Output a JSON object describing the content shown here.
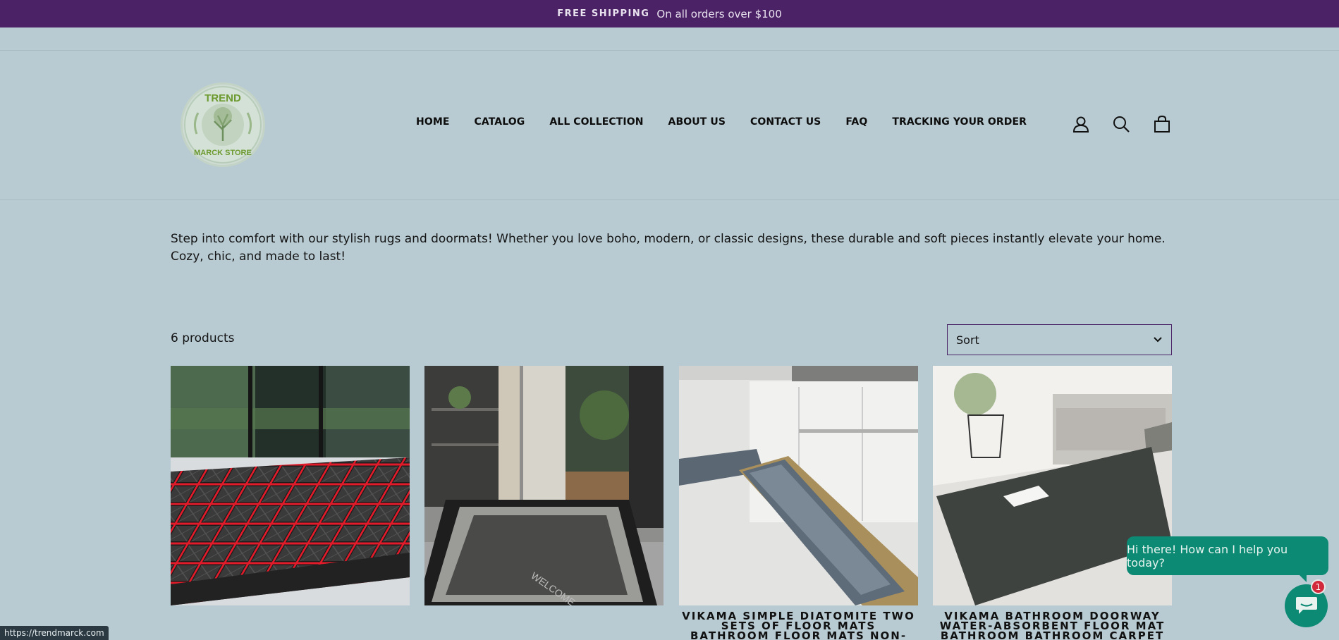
{
  "announcement": {
    "bold": "FREE SHIPPING",
    "text": "On all orders over $100"
  },
  "logo": {
    "top_text": "TREND",
    "bottom_text": "MARCK STORE"
  },
  "nav": [
    "HOME",
    "CATALOG",
    "ALL COLLECTION",
    "ABOUT US",
    "CONTACT US",
    "FAQ",
    "TRACKING YOUR ORDER"
  ],
  "header_icons": [
    "account-icon",
    "search-icon",
    "cart-icon"
  ],
  "description": "Step into comfort with our stylish rugs and doormats! Whether you love boho, modern, or classic designs, these durable and soft pieces instantly elevate your home. Cozy, chic, and made to last!",
  "collection": {
    "count_label": "6 products",
    "sort_label": "Sort"
  },
  "products": [
    {
      "title": ""
    },
    {
      "title": "",
      "mat_text": "WELCOME"
    },
    {
      "title": "VIKAMA SIMPLE DIATOMITE TWO SETS OF FLOOR MATS BATHROOM FLOOR MATS NON-SLIP WATER-ABSORBENT"
    },
    {
      "title": "VIKAMA BATHROOM DOORWAY WATER-ABSORBENT FLOOR MAT BATHROOM BATHROOM CARPET"
    }
  ],
  "chat": {
    "greeting": "Hi there! How can I help you today?",
    "badge": "1"
  },
  "status_url": "https://trendmarck.com",
  "colors": {
    "announcement_bg": "#4b2266",
    "page_bg": "#b8cbd2",
    "chat": "#0c8a74",
    "badge": "#d1283c"
  }
}
